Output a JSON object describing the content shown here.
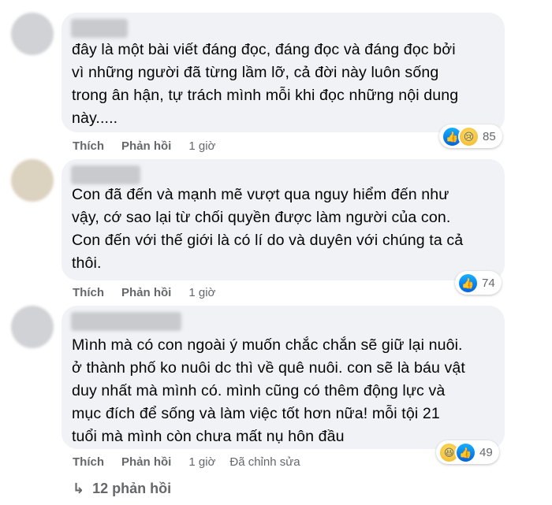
{
  "comments": [
    {
      "text": "đây là một bài viết đáng đọc, đáng đọc và đáng đọc bởi\nvì những người đã từng lầm lỡ, cả đời này luôn sống\ntrong ân hận, tự trách mình mỗi khi đọc những nội dung\nnày.....",
      "like_label": "Thích",
      "reply_label": "Phản hồi",
      "time": "1 giờ",
      "reactions": [
        "like",
        "sad"
      ],
      "reaction_count": "85"
    },
    {
      "text": "Con đã đến và mạnh mẽ vượt qua nguy hiểm đến như\nvậy, cớ sao lại từ chối quyền được làm người của con.\nCon đến với thế giới là có lí do và duyên với chúng ta cả\nthôi.",
      "like_label": "Thích",
      "reply_label": "Phản hồi",
      "time": "1 giờ",
      "reactions": [
        "like"
      ],
      "reaction_count": "74"
    },
    {
      "text": "Mình mà có con ngoài ý muốn chắc chắn sẽ giữ lại nuôi.\nở thành phố ko nuôi dc thì về quê nuôi. con sẽ là báu vật\nduy nhất mà mình có. mình cũng có thêm động lực và\nmục đích để sống và làm việc tốt hơn nữa! mỗi tội 21\ntuổi mà mình còn chưa mất nụ hôn đầu",
      "like_label": "Thích",
      "reply_label": "Phản hồi",
      "time": "1 giờ",
      "edited": "Đã chỉnh sửa",
      "reactions": [
        "haha",
        "like"
      ],
      "reaction_count": "49"
    }
  ],
  "more_replies": "12 phản hồi",
  "colors": {
    "bubble": "#f0f2f5",
    "meta": "#65676b",
    "like": "#0866ff"
  }
}
